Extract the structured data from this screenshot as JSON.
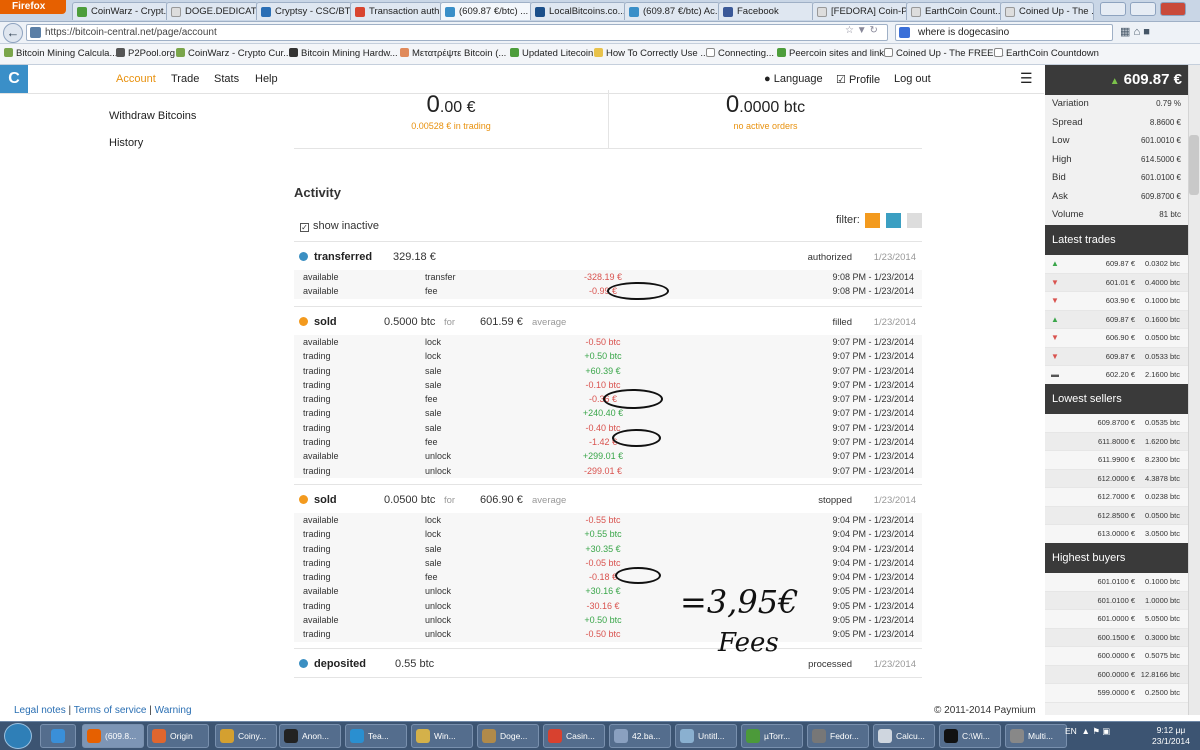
{
  "browser": {
    "menu_button": "Firefox",
    "tabs": [
      {
        "label": "CoinWarz - Crypt..."
      },
      {
        "label": "DOGE.DEDICATE..."
      },
      {
        "label": "Cryptsy - CSC/BT..."
      },
      {
        "label": "Transaction auth..."
      },
      {
        "label": "(609.87 €/btc) ..."
      },
      {
        "label": "LocalBitcoins.co..."
      },
      {
        "label": "(609.87 €/btc) Ac..."
      },
      {
        "label": "Facebook"
      },
      {
        "label": "[FEDORA] Coin-P..."
      },
      {
        "label": "EarthCoin Count..."
      },
      {
        "label": "Coined Up - The ..."
      }
    ],
    "url": "https://bitcoin-central.net/page/account",
    "search_query": "where is dogecasino",
    "bookmarks": [
      "Bitcoin Mining Calcula...",
      "P2Pool.org",
      "CoinWarz - Crypto Cur...",
      "Bitcoin Mining Hardw...",
      "Μετατρέψτε Bitcoin (...",
      "Updated Litecoin",
      "How To Correctly Use ...",
      "Connecting...",
      "Peercoin sites and links",
      "Coined Up - The FREE ...",
      "EarthCoin Countdown"
    ]
  },
  "nav": {
    "items": [
      "Account",
      "Trade",
      "Stats",
      "Help"
    ],
    "language": "Language",
    "profile": "Profile",
    "logout": "Log out"
  },
  "leftmenu": [
    "Withdraw Bitcoins",
    "History"
  ],
  "balances": {
    "eur_int": "0",
    "eur_dec": ".00 €",
    "eur_sub": "0.00528 € in trading",
    "btc_int": "0",
    "btc_dec": ".0000 btc",
    "btc_sub": "no active orders"
  },
  "activity": {
    "title": "Activity",
    "show_inactive": "show inactive",
    "filter_label": "filter:",
    "filter_colors": [
      "#f39a1e",
      "#3b9fc2",
      "#dddddd"
    ],
    "groups": [
      {
        "type": "transferred",
        "amount": "329.18 €",
        "status": "authorized",
        "date": "1/23/2014",
        "rows": [
          [
            "available",
            "transfer",
            "-328.19 €",
            "9:08 PM - 1/23/2014"
          ],
          [
            "available",
            "fee",
            "-0.99 €",
            "9:08 PM - 1/23/2014"
          ]
        ]
      },
      {
        "type": "sold",
        "amount": "0.5000 btc",
        "for": "for",
        "price": "601.59 €",
        "avg": "average",
        "status": "filled",
        "date": "1/23/2014",
        "rows": [
          [
            "available",
            "lock",
            "-0.50 btc",
            "9:07 PM - 1/23/2014"
          ],
          [
            "trading",
            "lock",
            "+0.50 btc",
            "9:07 PM - 1/23/2014"
          ],
          [
            "trading",
            "sale",
            "+60.39 €",
            "9:07 PM - 1/23/2014"
          ],
          [
            "trading",
            "sale",
            "-0.10 btc",
            "9:07 PM - 1/23/2014"
          ],
          [
            "trading",
            "fee",
            "-0.36 €",
            "9:07 PM - 1/23/2014"
          ],
          [
            "trading",
            "sale",
            "+240.40 €",
            "9:07 PM - 1/23/2014"
          ],
          [
            "trading",
            "sale",
            "-0.40 btc",
            "9:07 PM - 1/23/2014"
          ],
          [
            "trading",
            "fee",
            "-1.42 €",
            "9:07 PM - 1/23/2014"
          ],
          [
            "available",
            "unlock",
            "+299.01 €",
            "9:07 PM - 1/23/2014"
          ],
          [
            "trading",
            "unlock",
            "-299.01 €",
            "9:07 PM - 1/23/2014"
          ]
        ]
      },
      {
        "type": "sold",
        "amount": "0.0500 btc",
        "for": "for",
        "price": "606.90 €",
        "avg": "average",
        "status": "stopped",
        "date": "1/23/2014",
        "rows": [
          [
            "available",
            "lock",
            "-0.55 btc",
            "9:04 PM - 1/23/2014"
          ],
          [
            "trading",
            "lock",
            "+0.55 btc",
            "9:04 PM - 1/23/2014"
          ],
          [
            "trading",
            "sale",
            "+30.35 €",
            "9:04 PM - 1/23/2014"
          ],
          [
            "trading",
            "sale",
            "-0.05 btc",
            "9:04 PM - 1/23/2014"
          ],
          [
            "trading",
            "fee",
            "-0.18 €",
            "9:04 PM - 1/23/2014"
          ],
          [
            "available",
            "unlock",
            "+30.16 €",
            "9:05 PM - 1/23/2014"
          ],
          [
            "trading",
            "unlock",
            "-30.16 €",
            "9:05 PM - 1/23/2014"
          ],
          [
            "available",
            "unlock",
            "+0.50 btc",
            "9:05 PM - 1/23/2014"
          ],
          [
            "trading",
            "unlock",
            "-0.50 btc",
            "9:05 PM - 1/23/2014"
          ]
        ]
      },
      {
        "type": "deposited",
        "amount": "0.55 btc",
        "status": "processed",
        "date": "1/23/2014",
        "rows": []
      }
    ]
  },
  "annotation": {
    "line1": "=3,95€",
    "line2": "Fees"
  },
  "ticker": {
    "price": "609.87 €",
    "stats": [
      [
        "Variation",
        "0.79 %"
      ],
      [
        "Spread",
        "8.8600 €"
      ],
      [
        "Low",
        "601.0010 €"
      ],
      [
        "High",
        "614.5000 €"
      ],
      [
        "Bid",
        "601.0100 €"
      ],
      [
        "Ask",
        "609.8700 €"
      ],
      [
        "Volume",
        "81 btc"
      ]
    ],
    "latest_title": "Latest trades",
    "latest": [
      [
        "up",
        "609.87 €",
        "0.0302 btc"
      ],
      [
        "down",
        "601.01 €",
        "0.4000 btc"
      ],
      [
        "down",
        "603.90 €",
        "0.1000 btc"
      ],
      [
        "up",
        "609.87 €",
        "0.1600 btc"
      ],
      [
        "down",
        "606.90 €",
        "0.0500 btc"
      ],
      [
        "down",
        "609.87 €",
        "0.0533 btc"
      ],
      [
        "flat",
        "602.20 €",
        "2.1600 btc"
      ]
    ],
    "sellers_title": "Lowest sellers",
    "sellers": [
      [
        "609.8700 €",
        "0.0535 btc"
      ],
      [
        "611.8000 €",
        "1.6200 btc"
      ],
      [
        "611.9900 €",
        "8.2300 btc"
      ],
      [
        "612.0000 €",
        "4.3878 btc"
      ],
      [
        "612.7000 €",
        "0.0238 btc"
      ],
      [
        "612.8500 €",
        "0.0500 btc"
      ],
      [
        "613.0000 €",
        "3.0500 btc"
      ]
    ],
    "buyers_title": "Highest buyers",
    "buyers": [
      [
        "601.0100 €",
        "0.1000 btc"
      ],
      [
        "601.0100 €",
        "1.0000 btc"
      ],
      [
        "601.0000 €",
        "5.0500 btc"
      ],
      [
        "600.1500 €",
        "0.3000 btc"
      ],
      [
        "600.0000 €",
        "0.5075 btc"
      ],
      [
        "600.0000 €",
        "12.8166 btc"
      ],
      [
        "599.0000 €",
        "0.2500 btc"
      ]
    ]
  },
  "footer": {
    "legal": "Legal notes",
    "terms": "Terms of service",
    "warning": "Warning",
    "copyright": "© 2011-2014 Paymium"
  },
  "taskbar": {
    "items": [
      "(609.8...",
      "Origin",
      "Coiny...",
      "Anon...",
      "Tea...",
      "Win...",
      "Doge...",
      "Casin...",
      "42.ba...",
      "Untitl...",
      "µTorr...",
      "Fedor...",
      "Calcu...",
      "C:\\Wi...",
      "Multi..."
    ],
    "lang": "EN",
    "time": "9:12 μμ",
    "date": "23/1/2014"
  }
}
